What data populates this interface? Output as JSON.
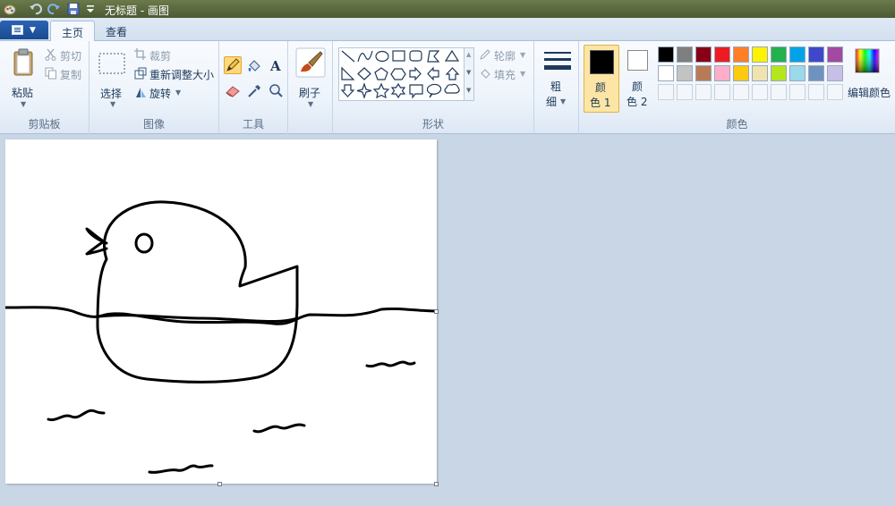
{
  "window": {
    "title": "无标题 - 画图"
  },
  "tabs": {
    "home": "主页",
    "view": "查看"
  },
  "clipboard": {
    "paste": "粘贴",
    "cut": "剪切",
    "copy": "复制",
    "group_label": "剪贴板"
  },
  "image": {
    "select": "选择",
    "crop": "裁剪",
    "resize": "重新调整大小",
    "rotate": "旋转",
    "group_label": "图像"
  },
  "tools": {
    "group_label": "工具",
    "active": "pencil"
  },
  "brushes": {
    "label": "刷子"
  },
  "shapes": {
    "outline": "轮廓",
    "fill": "填充",
    "group_label": "形状"
  },
  "size": {
    "label_top": "粗",
    "label_bottom": "细"
  },
  "colors": {
    "color1_top": "颜",
    "color1_bottom": "色 1",
    "color2_top": "颜",
    "color2_bottom": "色 2",
    "edit": "编辑颜色",
    "group_label": "颜色",
    "color1": "#000000",
    "color2": "#ffffff",
    "palette_row1": [
      "#000000",
      "#7f7f7f",
      "#880015",
      "#ed1c24",
      "#ff7f27",
      "#fff200",
      "#22b14c",
      "#00a2e8",
      "#3f48cc",
      "#a349a4"
    ],
    "palette_row2": [
      "#ffffff",
      "#c3c3c3",
      "#b97a57",
      "#ffaec9",
      "#ffc90e",
      "#efe4b0",
      "#b5e61d",
      "#99d9ea",
      "#7092be",
      "#c8bfe7"
    ]
  }
}
